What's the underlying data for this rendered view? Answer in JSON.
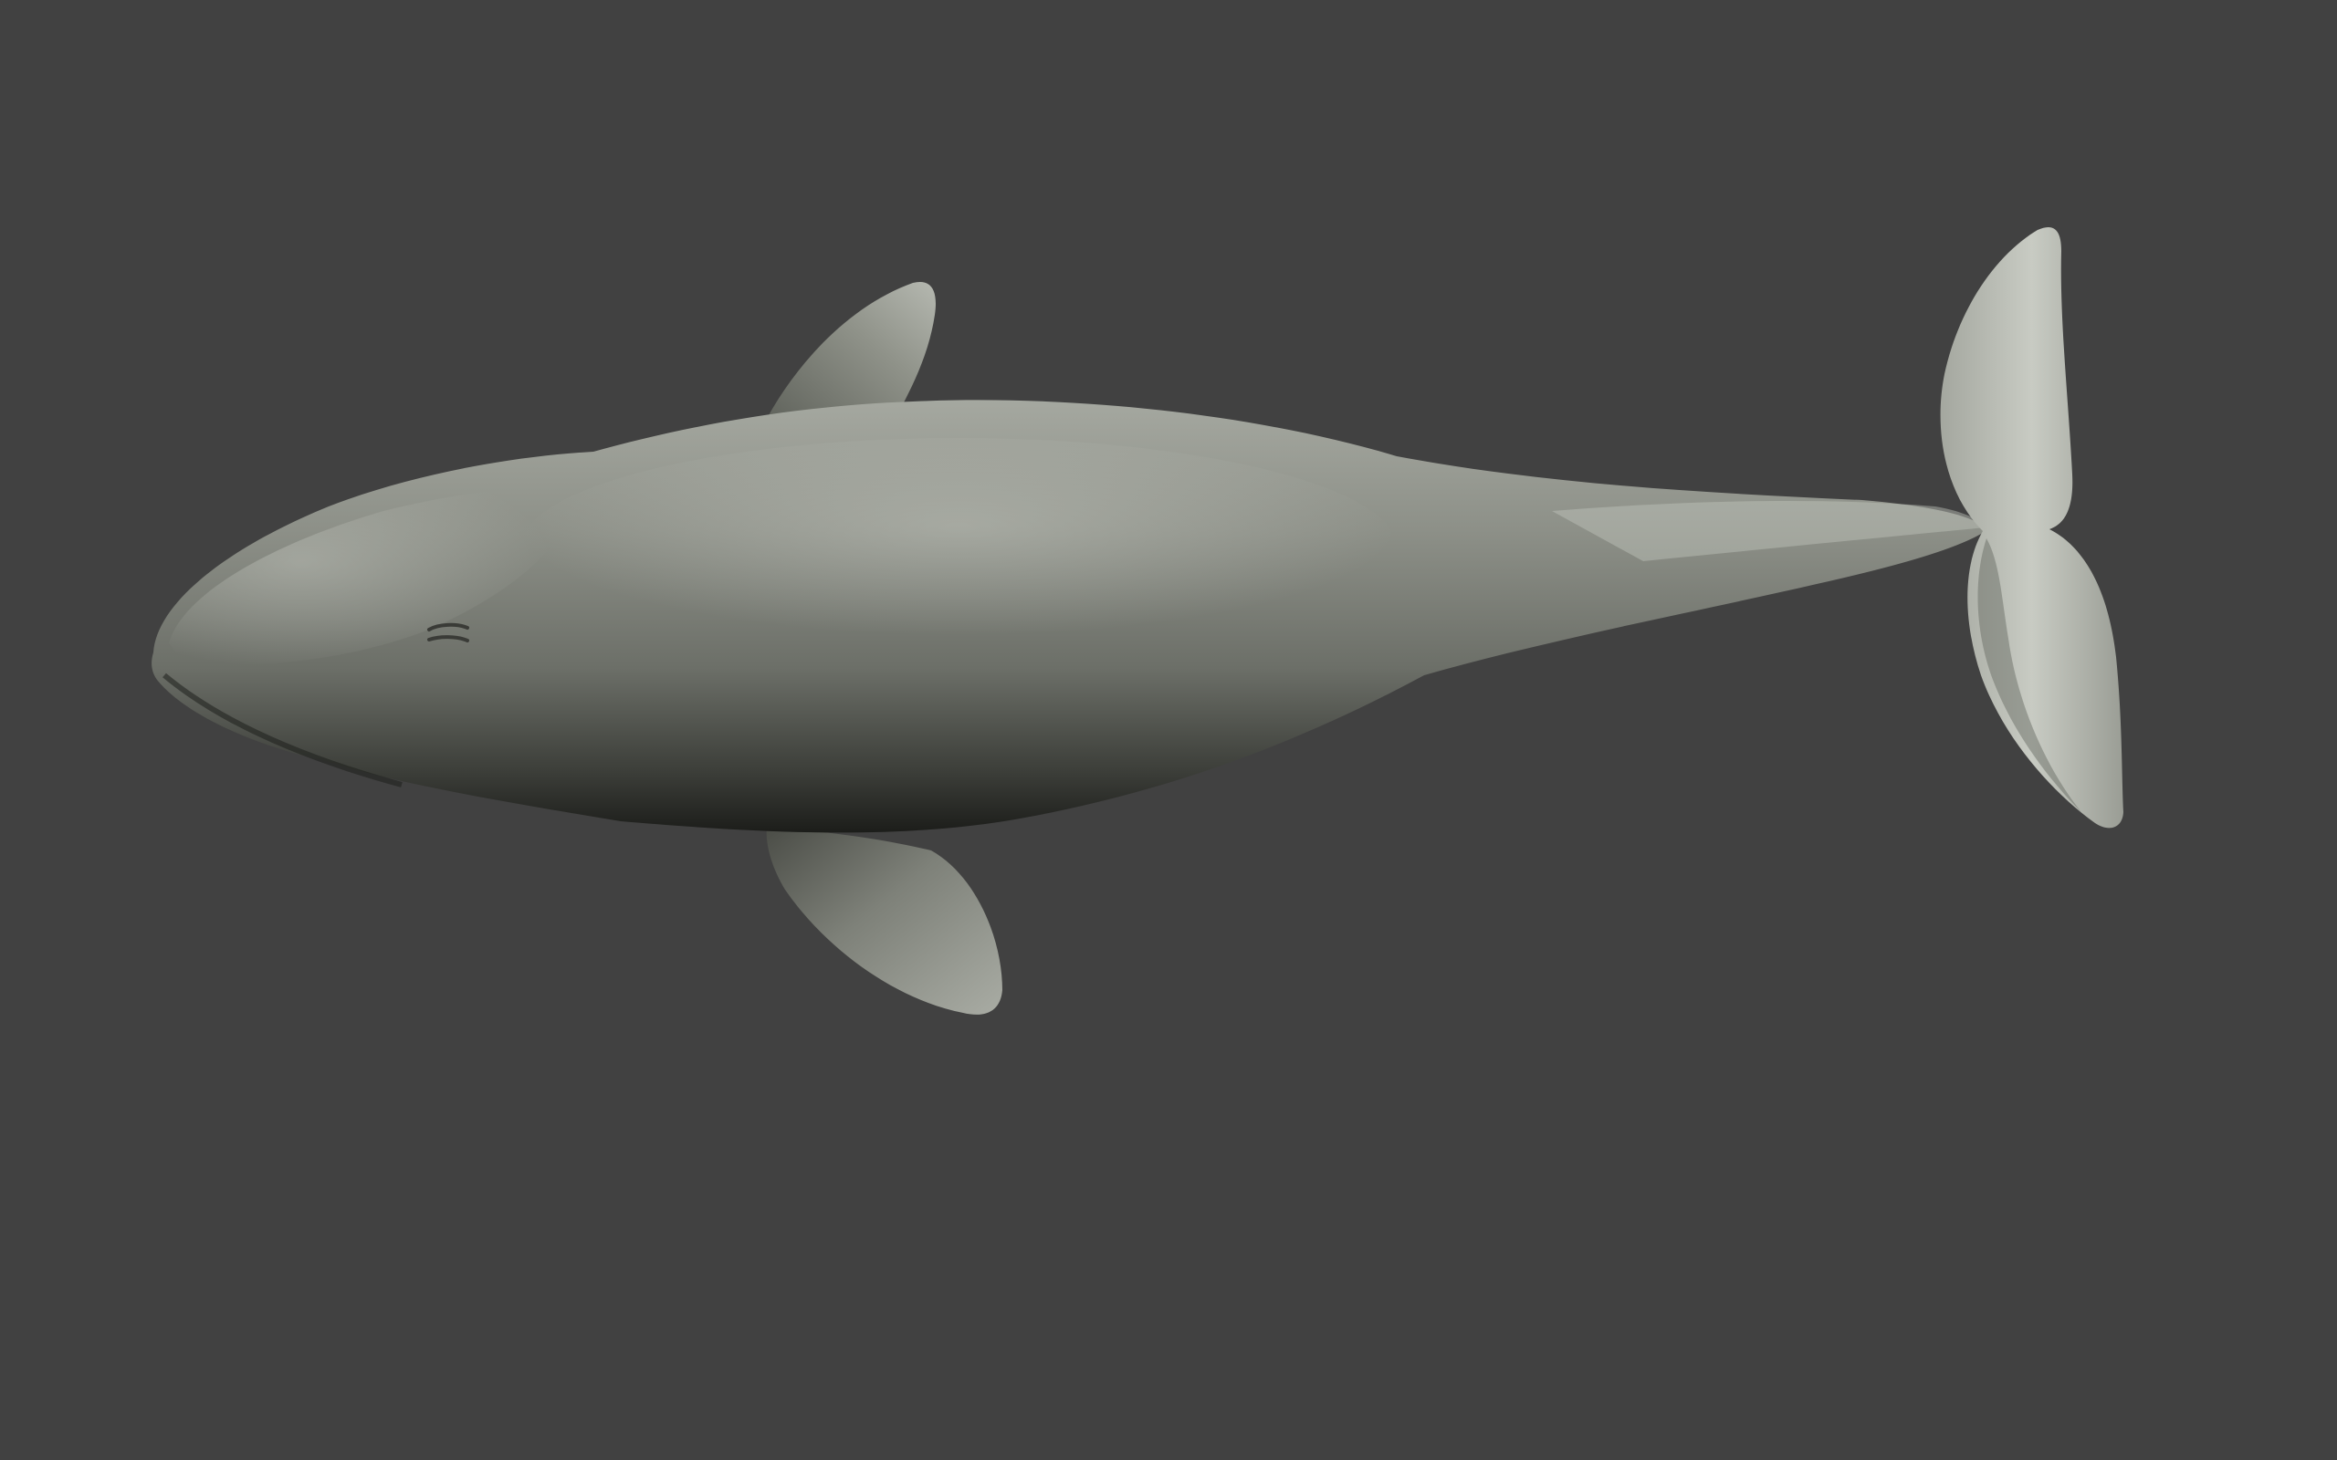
{
  "viewport": {
    "background_color": "#414141",
    "model_base_color": "#84877f",
    "model_highlight_color": "#c9ccc4",
    "model_shadow_color": "#22231f",
    "visible_text": []
  }
}
